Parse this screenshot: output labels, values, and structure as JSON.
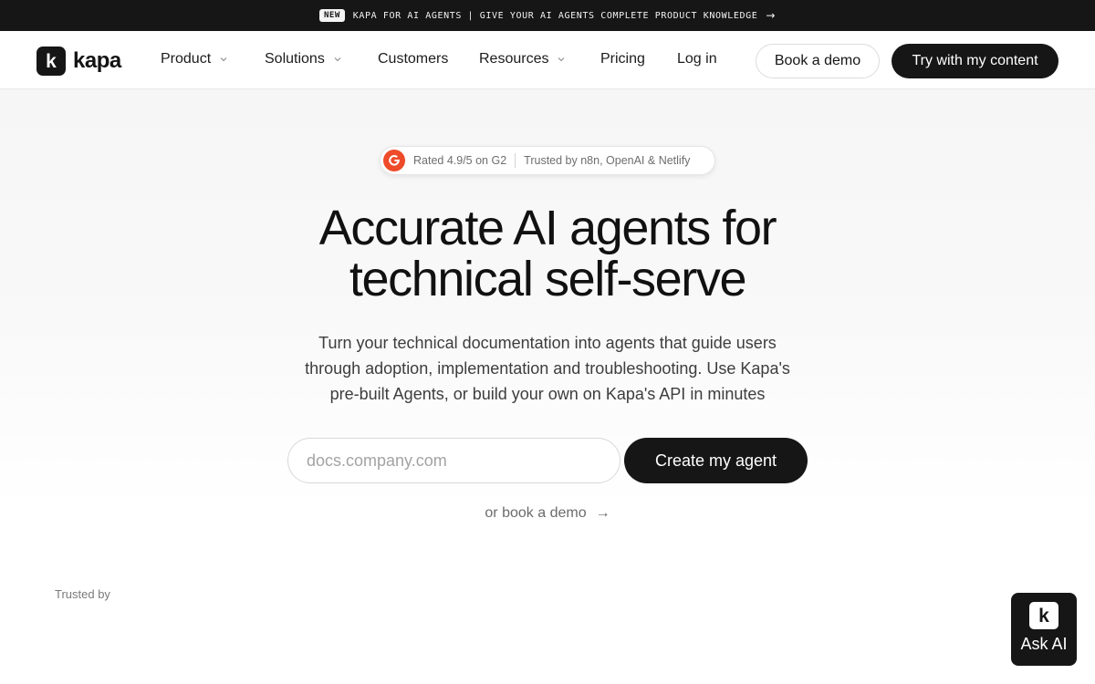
{
  "announcement": {
    "tag": "NEW",
    "text": "KAPA FOR AI AGENTS | GIVE YOUR AI AGENTS COMPLETE PRODUCT KNOWLEDGE"
  },
  "brand": {
    "mark": "k",
    "name": "kapa"
  },
  "nav": {
    "items": [
      {
        "label": "Product",
        "has_dropdown": true
      },
      {
        "label": "Solutions",
        "has_dropdown": true
      },
      {
        "label": "Customers",
        "has_dropdown": false
      },
      {
        "label": "Resources",
        "has_dropdown": true
      },
      {
        "label": "Pricing",
        "has_dropdown": false
      },
      {
        "label": "Log in",
        "has_dropdown": false
      }
    ],
    "book_demo": "Book a demo",
    "try_content": "Try with my content"
  },
  "hero": {
    "rating": "Rated 4.9/5 on G2",
    "trusted_by_badge": "Trusted by n8n, OpenAI & Netlify",
    "headline_line1": "Accurate AI agents for",
    "headline_line2": "technical self-serve",
    "sub_line1": "Turn your technical documentation into agents that guide users",
    "sub_line2": "through adoption, implementation and troubleshooting. Use Kapa's",
    "sub_line3": "pre-built Agents, or build your own on Kapa's API in minutes",
    "input_placeholder": "docs.company.com",
    "input_value": "",
    "create_button": "Create my agent",
    "book_link": "or book a demo",
    "trusted_label": "Trusted by"
  },
  "ask_ai": {
    "mark": "k",
    "label": "Ask AI"
  },
  "colors": {
    "dark": "#161616",
    "g2_red": "#ee4b2b",
    "text_muted": "#6b6b6b"
  }
}
